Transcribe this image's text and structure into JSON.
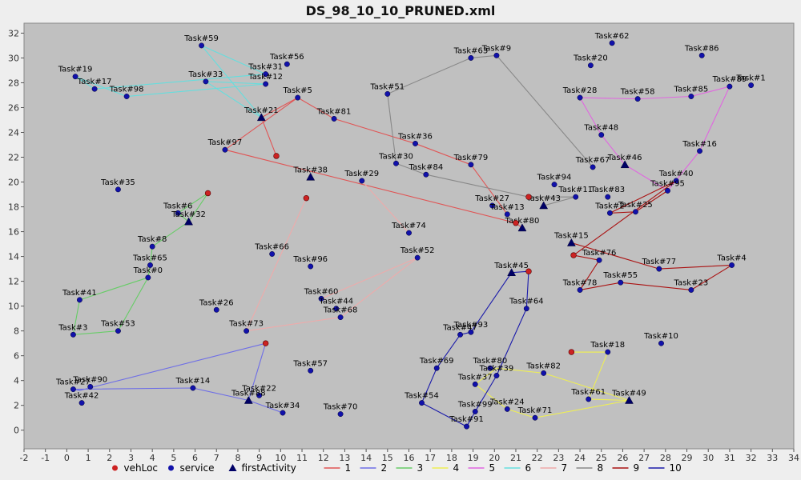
{
  "chart_data": {
    "type": "scatter",
    "title": "DS_98_10_10_PRUNED.xml",
    "xlim": [
      -2,
      34
    ],
    "ylim": [
      -1.5,
      32.8
    ],
    "x_ticks": [
      -2,
      -1,
      0,
      1,
      2,
      3,
      4,
      5,
      6,
      7,
      8,
      9,
      10,
      11,
      12,
      13,
      14,
      15,
      16,
      17,
      18,
      19,
      20,
      21,
      22,
      23,
      24,
      25,
      26,
      27,
      28,
      29,
      30,
      31,
      32,
      33,
      34
    ],
    "y_ticks": [
      0,
      2,
      4,
      6,
      8,
      10,
      12,
      14,
      16,
      18,
      20,
      22,
      24,
      26,
      28,
      30,
      32
    ],
    "grid": false,
    "legend_position": "bottom",
    "colors": {
      "background": "#c0c0c0",
      "vehLoc": "#cc2222",
      "service": "#1111aa",
      "firstActivity": "#000066",
      "routes": {
        "1": "#e05555",
        "2": "#6e6ee6",
        "3": "#66cc66",
        "4": "#eeee55",
        "5": "#e066e0",
        "6": "#66dddd",
        "7": "#eeaaaa",
        "8": "#888888",
        "9": "#aa1111",
        "10": "#1a1aaa"
      }
    },
    "legend": [
      {
        "key": "vehLoc",
        "label": "vehLoc",
        "kind": "dot"
      },
      {
        "key": "service",
        "label": "service",
        "kind": "dot"
      },
      {
        "key": "firstActivity",
        "label": "firstActivity",
        "kind": "triangle"
      },
      {
        "key": "1",
        "label": "1",
        "kind": "line"
      },
      {
        "key": "2",
        "label": "2",
        "kind": "line"
      },
      {
        "key": "3",
        "label": "3",
        "kind": "line"
      },
      {
        "key": "4",
        "label": "4",
        "kind": "line"
      },
      {
        "key": "5",
        "label": "5",
        "kind": "line"
      },
      {
        "key": "6",
        "label": "6",
        "kind": "line"
      },
      {
        "key": "7",
        "label": "7",
        "kind": "line"
      },
      {
        "key": "8",
        "label": "8",
        "kind": "line"
      },
      {
        "key": "9",
        "label": "9",
        "kind": "line"
      },
      {
        "key": "10",
        "label": "10",
        "kind": "line"
      }
    ],
    "vehLoc": [
      {
        "x": 9.8,
        "y": 22.1
      },
      {
        "x": 6.6,
        "y": 19.1
      },
      {
        "x": 11.2,
        "y": 18.7
      },
      {
        "x": 21.6,
        "y": 18.8
      },
      {
        "x": 21.0,
        "y": 16.7
      },
      {
        "x": 23.7,
        "y": 14.1
      },
      {
        "x": 21.6,
        "y": 12.8
      },
      {
        "x": 9.3,
        "y": 7.0
      },
      {
        "x": 23.6,
        "y": 6.3
      }
    ],
    "tasks": [
      {
        "label": "Task#59",
        "x": 6.3,
        "y": 31.0
      },
      {
        "label": "Task#56",
        "x": 10.3,
        "y": 29.5
      },
      {
        "label": "Task#31",
        "x": 9.3,
        "y": 28.7
      },
      {
        "label": "Task#33",
        "x": 6.5,
        "y": 28.1
      },
      {
        "label": "Task#12",
        "x": 9.3,
        "y": 27.9
      },
      {
        "label": "Task#19",
        "x": 0.4,
        "y": 28.5
      },
      {
        "label": "Task#17",
        "x": 1.3,
        "y": 27.5
      },
      {
        "label": "Task#98",
        "x": 2.8,
        "y": 26.9
      },
      {
        "label": "Task#5",
        "x": 10.8,
        "y": 26.8
      },
      {
        "label": "Task#81",
        "x": 12.5,
        "y": 25.1
      },
      {
        "label": "Task#21",
        "x": 9.1,
        "y": 25.2,
        "first": true
      },
      {
        "label": "Task#97",
        "x": 7.4,
        "y": 22.6
      },
      {
        "label": "Task#9",
        "x": 20.1,
        "y": 30.2
      },
      {
        "label": "Task#63",
        "x": 18.9,
        "y": 30.0
      },
      {
        "label": "Task#51",
        "x": 15.0,
        "y": 27.1
      },
      {
        "label": "Task#62",
        "x": 25.5,
        "y": 31.2
      },
      {
        "label": "Task#86",
        "x": 29.7,
        "y": 30.2
      },
      {
        "label": "Task#20",
        "x": 24.5,
        "y": 29.4
      },
      {
        "label": "Task#28",
        "x": 24.0,
        "y": 26.8
      },
      {
        "label": "Task#58",
        "x": 26.7,
        "y": 26.7
      },
      {
        "label": "Task#85",
        "x": 29.2,
        "y": 26.9
      },
      {
        "label": "Task#89",
        "x": 31.0,
        "y": 27.7
      },
      {
        "label": "Task#1",
        "x": 32.0,
        "y": 27.8
      },
      {
        "label": "Task#48",
        "x": 25.0,
        "y": 23.8
      },
      {
        "label": "Task#16",
        "x": 29.6,
        "y": 22.5
      },
      {
        "label": "Task#67",
        "x": 24.6,
        "y": 21.2
      },
      {
        "label": "Task#46",
        "x": 26.1,
        "y": 21.4,
        "first": true
      },
      {
        "label": "Task#36",
        "x": 16.3,
        "y": 23.1
      },
      {
        "label": "Task#79",
        "x": 18.9,
        "y": 21.4
      },
      {
        "label": "Task#30",
        "x": 15.4,
        "y": 21.5
      },
      {
        "label": "Task#84",
        "x": 16.8,
        "y": 20.6
      },
      {
        "label": "Task#38",
        "x": 11.4,
        "y": 20.4,
        "first": true
      },
      {
        "label": "Task#29",
        "x": 13.8,
        "y": 20.1
      },
      {
        "label": "Task#35",
        "x": 2.4,
        "y": 19.4
      },
      {
        "label": "Task#94",
        "x": 22.8,
        "y": 19.8
      },
      {
        "label": "Task#40",
        "x": 28.5,
        "y": 20.1
      },
      {
        "label": "Task#95",
        "x": 28.1,
        "y": 19.3
      },
      {
        "label": "Task#11",
        "x": 23.8,
        "y": 18.8
      },
      {
        "label": "Task#83",
        "x": 25.3,
        "y": 18.8
      },
      {
        "label": "Task#2",
        "x": 25.4,
        "y": 17.5
      },
      {
        "label": "Task#25",
        "x": 26.6,
        "y": 17.6
      },
      {
        "label": "Task#27",
        "x": 19.9,
        "y": 18.1
      },
      {
        "label": "Task#43",
        "x": 22.3,
        "y": 18.1,
        "first": true
      },
      {
        "label": "Task#13",
        "x": 20.6,
        "y": 17.4
      },
      {
        "label": "Task#80",
        "x": 21.3,
        "y": 16.3,
        "first": true
      },
      {
        "label": "Task#6",
        "x": 5.2,
        "y": 17.5
      },
      {
        "label": "Task#32",
        "x": 5.7,
        "y": 16.8,
        "first": true
      },
      {
        "label": "Task#74",
        "x": 16.0,
        "y": 15.9
      },
      {
        "label": "Task#8",
        "x": 4.0,
        "y": 14.8
      },
      {
        "label": "Task#66",
        "x": 9.6,
        "y": 14.2
      },
      {
        "label": "Task#52",
        "x": 16.4,
        "y": 13.9
      },
      {
        "label": "Task#15",
        "x": 23.6,
        "y": 15.1,
        "first": true
      },
      {
        "label": "Task#76",
        "x": 24.9,
        "y": 13.7
      },
      {
        "label": "Task#77",
        "x": 27.7,
        "y": 13.0
      },
      {
        "label": "Task#4",
        "x": 31.1,
        "y": 13.3
      },
      {
        "label": "Task#65",
        "x": 3.9,
        "y": 13.3
      },
      {
        "label": "Task#96",
        "x": 11.4,
        "y": 13.2
      },
      {
        "label": "Task#0",
        "x": 3.8,
        "y": 12.3
      },
      {
        "label": "Task#45",
        "x": 20.8,
        "y": 12.7,
        "first": true
      },
      {
        "label": "Task#55",
        "x": 25.9,
        "y": 11.9
      },
      {
        "label": "Task#23",
        "x": 29.2,
        "y": 11.3
      },
      {
        "label": "Task#78",
        "x": 24.0,
        "y": 11.3
      },
      {
        "label": "Task#41",
        "x": 0.6,
        "y": 10.5
      },
      {
        "label": "Task#60",
        "x": 11.9,
        "y": 10.6
      },
      {
        "label": "Task#44",
        "x": 12.6,
        "y": 9.8
      },
      {
        "label": "Task#68",
        "x": 12.8,
        "y": 9.1
      },
      {
        "label": "Task#26",
        "x": 7.0,
        "y": 9.7
      },
      {
        "label": "Task#64",
        "x": 21.5,
        "y": 9.8
      },
      {
        "label": "Task#73",
        "x": 8.4,
        "y": 8.0
      },
      {
        "label": "Task#53",
        "x": 2.4,
        "y": 8.0
      },
      {
        "label": "Task#3",
        "x": 0.3,
        "y": 7.7
      },
      {
        "label": "Task#47",
        "x": 18.4,
        "y": 7.7
      },
      {
        "label": "Task#93",
        "x": 18.9,
        "y": 7.9
      },
      {
        "label": "Task#10",
        "x": 27.8,
        "y": 7.0
      },
      {
        "label": "Task#18",
        "x": 25.3,
        "y": 6.3
      },
      {
        "label": "Task#69",
        "x": 17.3,
        "y": 5.0
      },
      {
        "label": "Task#57",
        "x": 11.4,
        "y": 4.8
      },
      {
        "label": "Task#80b",
        "x": 19.8,
        "y": 5.0
      },
      {
        "label": "Task#39",
        "x": 20.1,
        "y": 4.4
      },
      {
        "label": "Task#82",
        "x": 22.3,
        "y": 4.6
      },
      {
        "label": "Task#37",
        "x": 19.1,
        "y": 3.7
      },
      {
        "label": "Task#27b",
        "x": 0.3,
        "y": 3.3
      },
      {
        "label": "Task#90",
        "x": 1.1,
        "y": 3.5
      },
      {
        "label": "Task#42",
        "x": 0.7,
        "y": 2.2
      },
      {
        "label": "Task#14",
        "x": 5.9,
        "y": 3.4
      },
      {
        "label": "Task#22",
        "x": 9.0,
        "y": 2.8
      },
      {
        "label": "Task#88",
        "x": 8.5,
        "y": 2.4,
        "first": true
      },
      {
        "label": "Task#34",
        "x": 10.1,
        "y": 1.4
      },
      {
        "label": "Task#70",
        "x": 12.8,
        "y": 1.3
      },
      {
        "label": "Task#54",
        "x": 16.6,
        "y": 2.2
      },
      {
        "label": "Task#99",
        "x": 19.1,
        "y": 1.5
      },
      {
        "label": "Task#91",
        "x": 18.7,
        "y": 0.3
      },
      {
        "label": "Task#24",
        "x": 20.6,
        "y": 1.7
      },
      {
        "label": "Task#71",
        "x": 21.9,
        "y": 1.0
      },
      {
        "label": "Task#61",
        "x": 24.4,
        "y": 2.5
      },
      {
        "label": "Task#49",
        "x": 26.3,
        "y": 2.4,
        "first": true
      }
    ],
    "routes": [
      {
        "id": "1",
        "points": [
          [
            9.8,
            22.1
          ],
          [
            9.1,
            25.2
          ],
          [
            10.8,
            26.8
          ],
          [
            7.4,
            22.6
          ],
          [
            21.0,
            16.7
          ],
          [
            21.3,
            16.3
          ]
        ],
        "extra": [
          [
            [
              10.8,
              26.8
            ],
            [
              12.5,
              25.1
            ],
            [
              16.3,
              23.1
            ],
            [
              18.9,
              21.4
            ],
            [
              20.6,
              17.4
            ]
          ]
        ]
      },
      {
        "id": "2",
        "points": [
          [
            9.3,
            7.0
          ],
          [
            8.5,
            2.4
          ],
          [
            5.9,
            3.4
          ],
          [
            0.3,
            3.3
          ],
          [
            0.6,
            3.2
          ],
          [
            9.3,
            7.0
          ]
        ],
        "extra": [
          [
            [
              8.5,
              2.4
            ],
            [
              10.1,
              1.4
            ]
          ]
        ]
      },
      {
        "id": "3",
        "points": [
          [
            6.6,
            19.1
          ],
          [
            5.7,
            16.8
          ],
          [
            4.0,
            14.8
          ],
          [
            3.9,
            13.3
          ],
          [
            3.8,
            12.3
          ],
          [
            0.6,
            10.5
          ],
          [
            0.3,
            7.7
          ],
          [
            2.4,
            8.0
          ],
          [
            3.8,
            12.3
          ]
        ],
        "extra": [
          [
            [
              6.6,
              19.1
            ],
            [
              5.2,
              17.5
            ],
            [
              5.7,
              16.8
            ]
          ]
        ]
      },
      {
        "id": "4",
        "points": [
          [
            23.6,
            6.3
          ],
          [
            25.3,
            6.3
          ],
          [
            24.4,
            2.5
          ],
          [
            26.3,
            2.4
          ],
          [
            21.9,
            1.0
          ],
          [
            20.6,
            1.7
          ],
          [
            19.1,
            3.7
          ],
          [
            20.1,
            5.0
          ],
          [
            22.3,
            4.6
          ],
          [
            26.3,
            2.4
          ]
        ],
        "extra": [
          [
            [
              23.6,
              6.3
            ],
            [
              25.3,
              6.3
            ]
          ]
        ]
      },
      {
        "id": "5",
        "points": [
          [
            28.1,
            19.3
          ],
          [
            29.6,
            22.5
          ],
          [
            31.0,
            27.7
          ],
          [
            29.2,
            26.9
          ],
          [
            26.7,
            26.7
          ],
          [
            24.0,
            26.8
          ],
          [
            25.0,
            23.8
          ],
          [
            26.1,
            21.4
          ],
          [
            28.1,
            19.3
          ]
        ]
      },
      {
        "id": "6",
        "points": [
          [
            9.1,
            25.2
          ],
          [
            6.3,
            31.0
          ],
          [
            9.3,
            28.7
          ],
          [
            1.3,
            27.5
          ],
          [
            0.4,
            28.5
          ],
          [
            2.8,
            26.9
          ],
          [
            9.3,
            27.9
          ],
          [
            6.5,
            28.1
          ],
          [
            9.1,
            25.2
          ]
        ]
      },
      {
        "id": "7",
        "points": [
          [
            11.2,
            18.7
          ],
          [
            8.4,
            8.0
          ],
          [
            12.8,
            9.1
          ],
          [
            16.4,
            13.9
          ],
          [
            11.9,
            10.6
          ]
        ],
        "extra": [
          [
            [
              13.8,
              20.1
            ],
            [
              16.0,
              15.9
            ]
          ]
        ]
      },
      {
        "id": "8",
        "points": [
          [
            22.3,
            18.1
          ],
          [
            23.8,
            18.8
          ],
          [
            21.6,
            18.8
          ],
          [
            16.8,
            20.6
          ],
          [
            15.4,
            21.5
          ],
          [
            15.0,
            27.1
          ],
          [
            18.9,
            30.0
          ],
          [
            20.1,
            30.2
          ],
          [
            24.6,
            21.2
          ]
        ]
      },
      {
        "id": "9",
        "points": [
          [
            23.7,
            14.1
          ],
          [
            28.5,
            20.1
          ],
          [
            25.4,
            17.5
          ],
          [
            26.6,
            17.6
          ],
          [
            28.1,
            19.3
          ]
        ],
        "extra": [
          [
            [
              23.6,
              15.1
            ],
            [
              27.7,
              13.0
            ],
            [
              31.1,
              13.3
            ],
            [
              29.2,
              11.3
            ],
            [
              25.9,
              11.9
            ],
            [
              24.0,
              11.3
            ],
            [
              24.9,
              13.7
            ],
            [
              23.7,
              14.1
            ]
          ]
        ]
      },
      {
        "id": "10",
        "points": [
          [
            21.6,
            12.8
          ],
          [
            20.8,
            12.7
          ],
          [
            18.9,
            7.9
          ],
          [
            18.4,
            7.7
          ],
          [
            17.3,
            5.0
          ],
          [
            16.6,
            2.2
          ],
          [
            18.7,
            0.3
          ],
          [
            19.1,
            1.5
          ],
          [
            20.1,
            4.4
          ],
          [
            21.5,
            9.8
          ],
          [
            21.6,
            12.8
          ]
        ]
      }
    ]
  }
}
